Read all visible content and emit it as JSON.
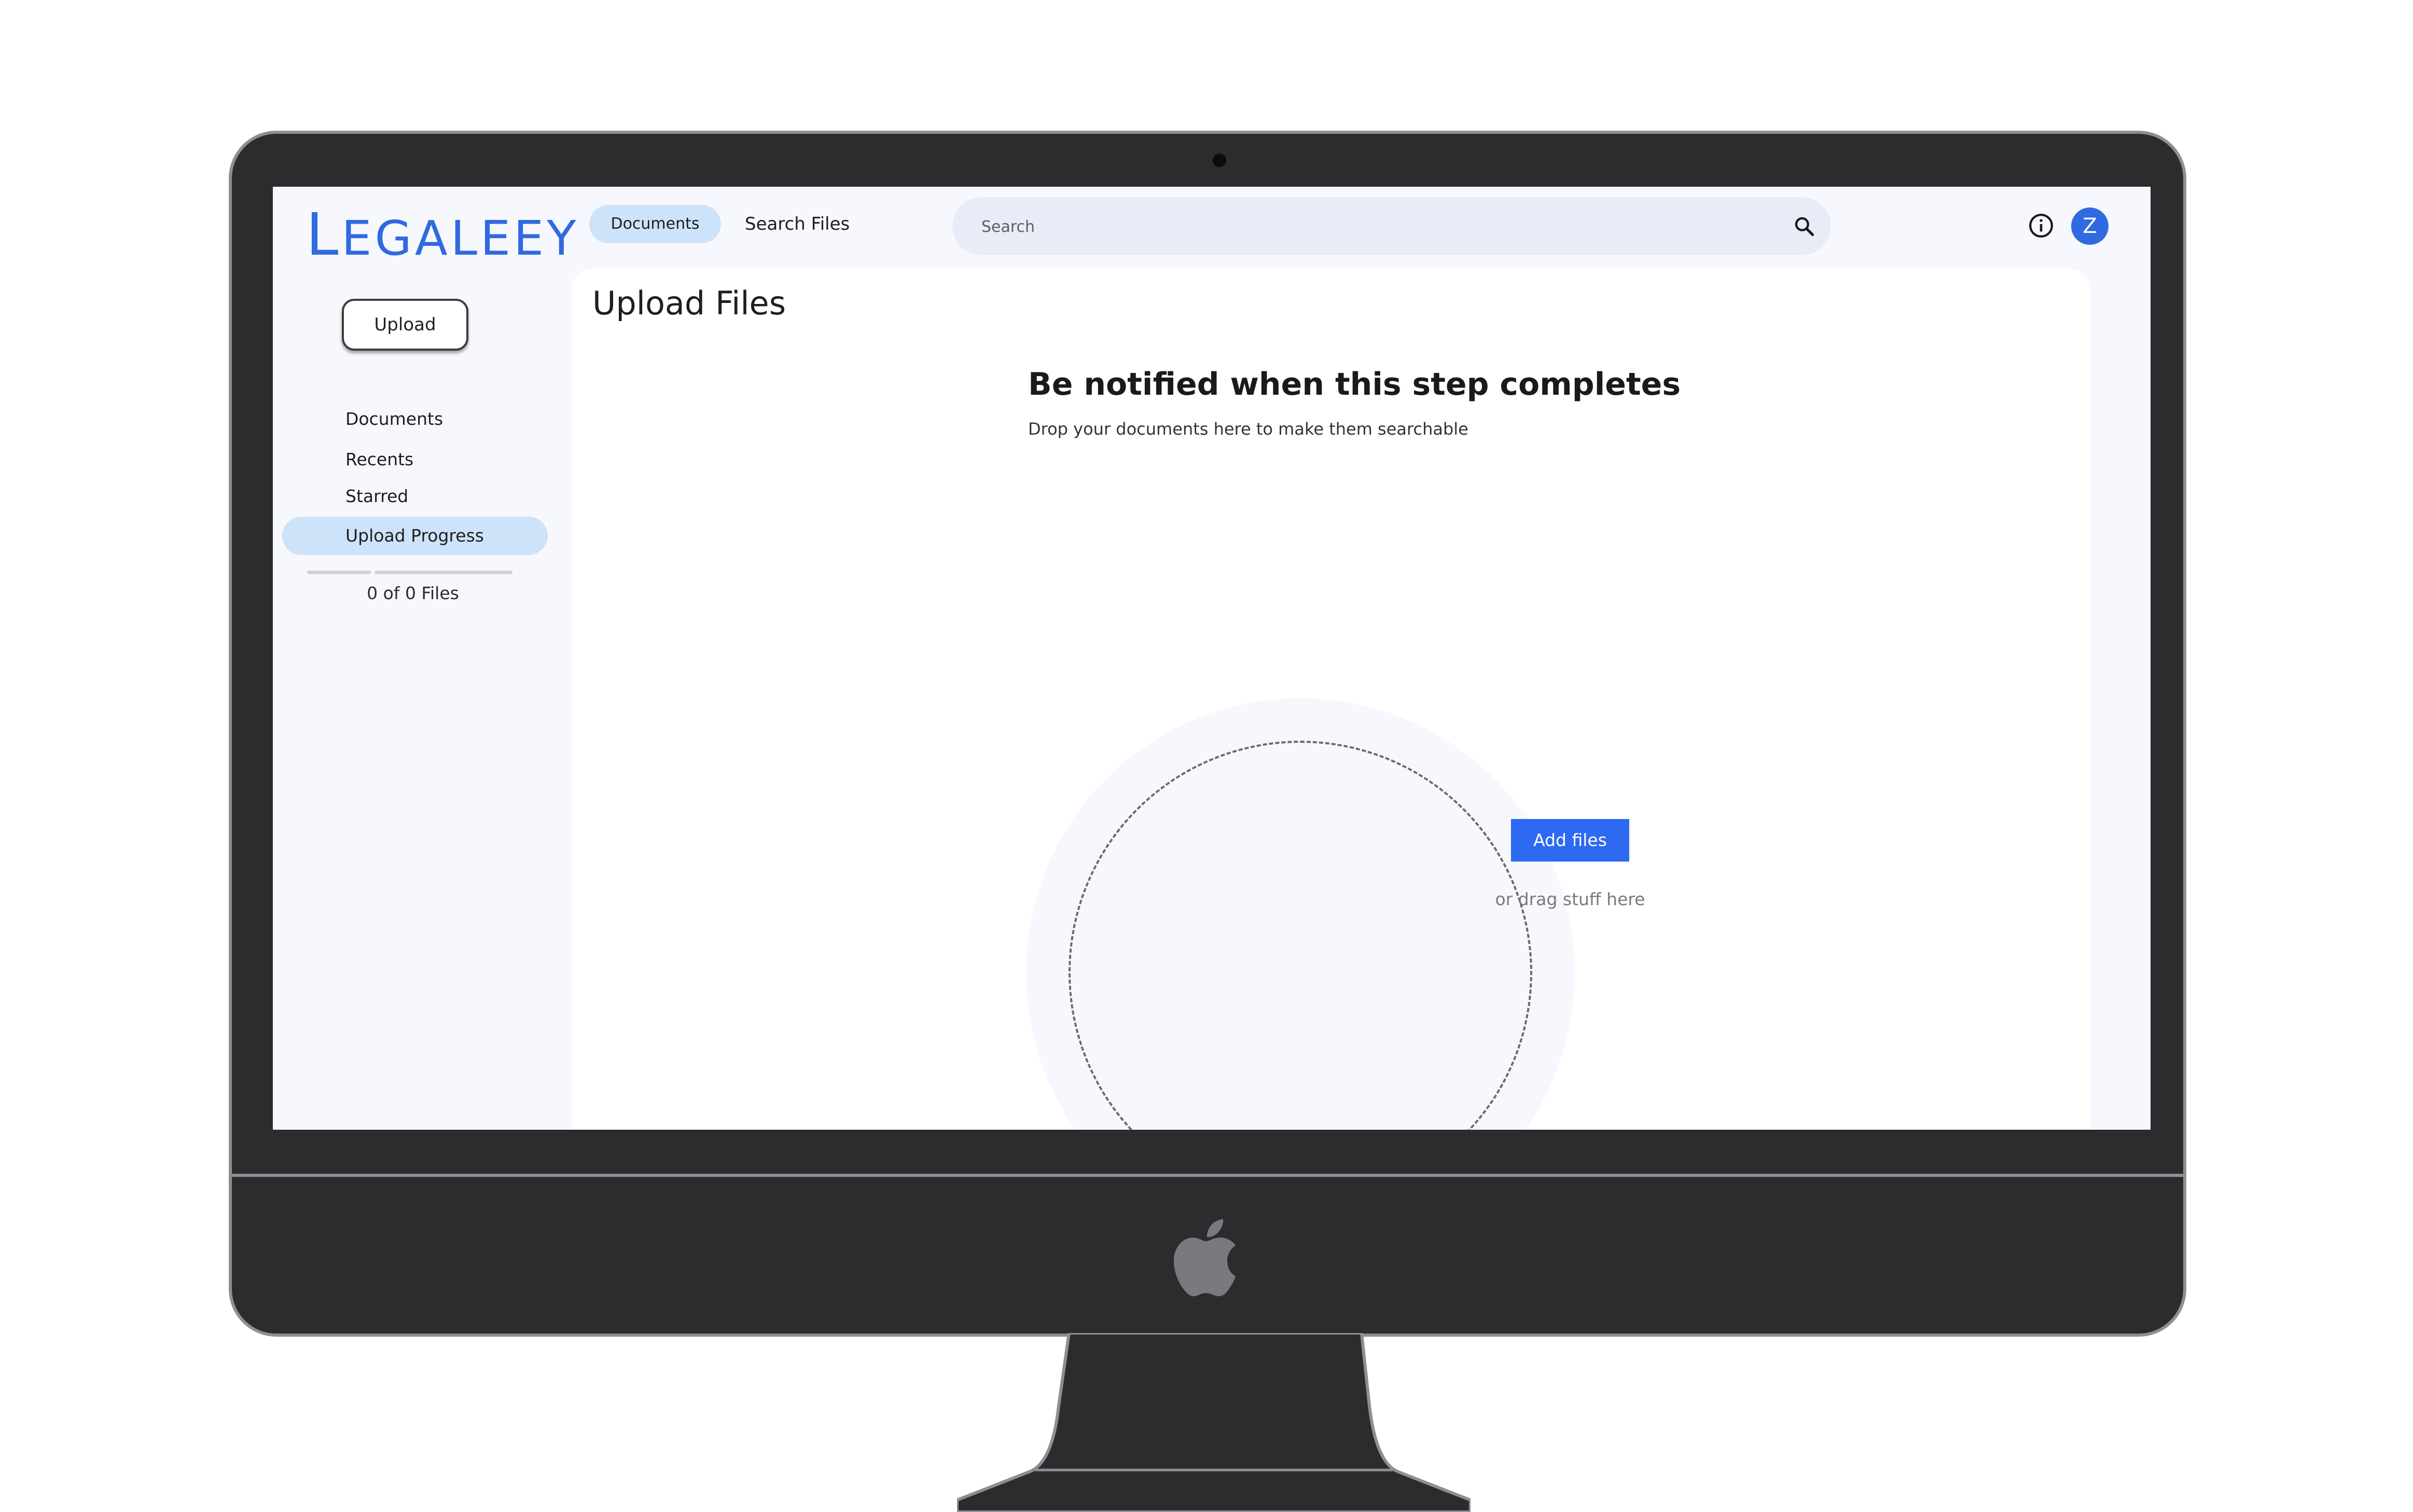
{
  "app": {
    "logo": "LEGALEEY"
  },
  "sidebar": {
    "upload_label": "Upload",
    "items": [
      {
        "label": "Documents",
        "active": false
      },
      {
        "label": "Recents",
        "active": false
      },
      {
        "label": "Starred",
        "active": false
      },
      {
        "label": "Upload Progress",
        "active": true
      }
    ],
    "progress": {
      "fraction": 0,
      "label": "0 of 0 Files"
    }
  },
  "topbar": {
    "tabs": [
      {
        "label": "Documents",
        "active": true
      },
      {
        "label": "Search Files",
        "active": false
      }
    ],
    "search": {
      "placeholder": "Search",
      "value": "",
      "icon": "search-icon"
    },
    "info_icon": "info-icon",
    "avatar_initial": "Z"
  },
  "main": {
    "title": "Upload Files",
    "heading": "Be notified when this step completes",
    "subtext": "Drop your documents here to make them searchable",
    "dropzone": {
      "button_label": "Add files",
      "hint": "or drag stuff here"
    }
  },
  "colors": {
    "accent": "#2f6ae0",
    "button": "#2d69f1",
    "active_pill": "#cde3fa",
    "screen_bg": "#f6f8fd",
    "bezel": "#2c2c2e"
  }
}
